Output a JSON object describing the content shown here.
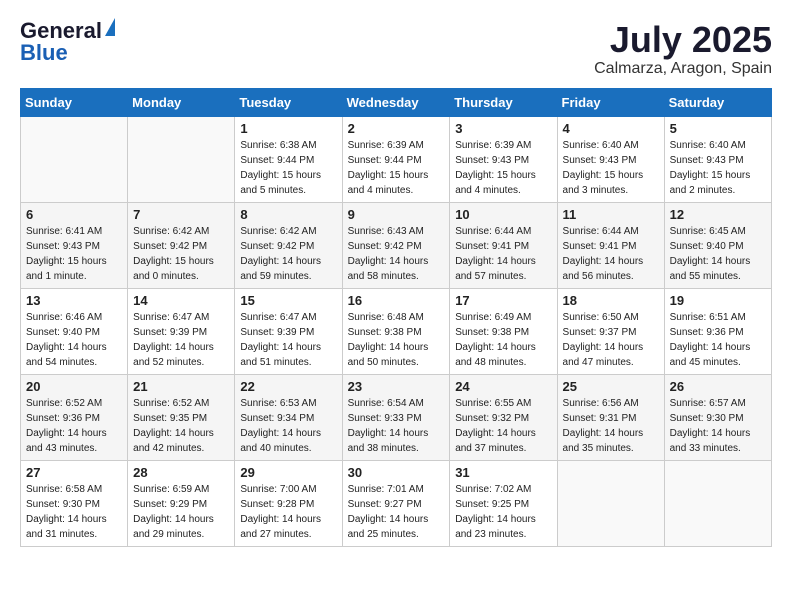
{
  "logo": {
    "general": "General",
    "blue": "Blue"
  },
  "title": {
    "month": "July 2025",
    "location": "Calmarza, Aragon, Spain"
  },
  "headers": [
    "Sunday",
    "Monday",
    "Tuesday",
    "Wednesday",
    "Thursday",
    "Friday",
    "Saturday"
  ],
  "weeks": [
    [
      {
        "day": "",
        "sunrise": "",
        "sunset": "",
        "daylight": ""
      },
      {
        "day": "",
        "sunrise": "",
        "sunset": "",
        "daylight": ""
      },
      {
        "day": "1",
        "sunrise": "Sunrise: 6:38 AM",
        "sunset": "Sunset: 9:44 PM",
        "daylight": "Daylight: 15 hours and 5 minutes."
      },
      {
        "day": "2",
        "sunrise": "Sunrise: 6:39 AM",
        "sunset": "Sunset: 9:44 PM",
        "daylight": "Daylight: 15 hours and 4 minutes."
      },
      {
        "day": "3",
        "sunrise": "Sunrise: 6:39 AM",
        "sunset": "Sunset: 9:43 PM",
        "daylight": "Daylight: 15 hours and 4 minutes."
      },
      {
        "day": "4",
        "sunrise": "Sunrise: 6:40 AM",
        "sunset": "Sunset: 9:43 PM",
        "daylight": "Daylight: 15 hours and 3 minutes."
      },
      {
        "day": "5",
        "sunrise": "Sunrise: 6:40 AM",
        "sunset": "Sunset: 9:43 PM",
        "daylight": "Daylight: 15 hours and 2 minutes."
      }
    ],
    [
      {
        "day": "6",
        "sunrise": "Sunrise: 6:41 AM",
        "sunset": "Sunset: 9:43 PM",
        "daylight": "Daylight: 15 hours and 1 minute."
      },
      {
        "day": "7",
        "sunrise": "Sunrise: 6:42 AM",
        "sunset": "Sunset: 9:42 PM",
        "daylight": "Daylight: 15 hours and 0 minutes."
      },
      {
        "day": "8",
        "sunrise": "Sunrise: 6:42 AM",
        "sunset": "Sunset: 9:42 PM",
        "daylight": "Daylight: 14 hours and 59 minutes."
      },
      {
        "day": "9",
        "sunrise": "Sunrise: 6:43 AM",
        "sunset": "Sunset: 9:42 PM",
        "daylight": "Daylight: 14 hours and 58 minutes."
      },
      {
        "day": "10",
        "sunrise": "Sunrise: 6:44 AM",
        "sunset": "Sunset: 9:41 PM",
        "daylight": "Daylight: 14 hours and 57 minutes."
      },
      {
        "day": "11",
        "sunrise": "Sunrise: 6:44 AM",
        "sunset": "Sunset: 9:41 PM",
        "daylight": "Daylight: 14 hours and 56 minutes."
      },
      {
        "day": "12",
        "sunrise": "Sunrise: 6:45 AM",
        "sunset": "Sunset: 9:40 PM",
        "daylight": "Daylight: 14 hours and 55 minutes."
      }
    ],
    [
      {
        "day": "13",
        "sunrise": "Sunrise: 6:46 AM",
        "sunset": "Sunset: 9:40 PM",
        "daylight": "Daylight: 14 hours and 54 minutes."
      },
      {
        "day": "14",
        "sunrise": "Sunrise: 6:47 AM",
        "sunset": "Sunset: 9:39 PM",
        "daylight": "Daylight: 14 hours and 52 minutes."
      },
      {
        "day": "15",
        "sunrise": "Sunrise: 6:47 AM",
        "sunset": "Sunset: 9:39 PM",
        "daylight": "Daylight: 14 hours and 51 minutes."
      },
      {
        "day": "16",
        "sunrise": "Sunrise: 6:48 AM",
        "sunset": "Sunset: 9:38 PM",
        "daylight": "Daylight: 14 hours and 50 minutes."
      },
      {
        "day": "17",
        "sunrise": "Sunrise: 6:49 AM",
        "sunset": "Sunset: 9:38 PM",
        "daylight": "Daylight: 14 hours and 48 minutes."
      },
      {
        "day": "18",
        "sunrise": "Sunrise: 6:50 AM",
        "sunset": "Sunset: 9:37 PM",
        "daylight": "Daylight: 14 hours and 47 minutes."
      },
      {
        "day": "19",
        "sunrise": "Sunrise: 6:51 AM",
        "sunset": "Sunset: 9:36 PM",
        "daylight": "Daylight: 14 hours and 45 minutes."
      }
    ],
    [
      {
        "day": "20",
        "sunrise": "Sunrise: 6:52 AM",
        "sunset": "Sunset: 9:36 PM",
        "daylight": "Daylight: 14 hours and 43 minutes."
      },
      {
        "day": "21",
        "sunrise": "Sunrise: 6:52 AM",
        "sunset": "Sunset: 9:35 PM",
        "daylight": "Daylight: 14 hours and 42 minutes."
      },
      {
        "day": "22",
        "sunrise": "Sunrise: 6:53 AM",
        "sunset": "Sunset: 9:34 PM",
        "daylight": "Daylight: 14 hours and 40 minutes."
      },
      {
        "day": "23",
        "sunrise": "Sunrise: 6:54 AM",
        "sunset": "Sunset: 9:33 PM",
        "daylight": "Daylight: 14 hours and 38 minutes."
      },
      {
        "day": "24",
        "sunrise": "Sunrise: 6:55 AM",
        "sunset": "Sunset: 9:32 PM",
        "daylight": "Daylight: 14 hours and 37 minutes."
      },
      {
        "day": "25",
        "sunrise": "Sunrise: 6:56 AM",
        "sunset": "Sunset: 9:31 PM",
        "daylight": "Daylight: 14 hours and 35 minutes."
      },
      {
        "day": "26",
        "sunrise": "Sunrise: 6:57 AM",
        "sunset": "Sunset: 9:30 PM",
        "daylight": "Daylight: 14 hours and 33 minutes."
      }
    ],
    [
      {
        "day": "27",
        "sunrise": "Sunrise: 6:58 AM",
        "sunset": "Sunset: 9:30 PM",
        "daylight": "Daylight: 14 hours and 31 minutes."
      },
      {
        "day": "28",
        "sunrise": "Sunrise: 6:59 AM",
        "sunset": "Sunset: 9:29 PM",
        "daylight": "Daylight: 14 hours and 29 minutes."
      },
      {
        "day": "29",
        "sunrise": "Sunrise: 7:00 AM",
        "sunset": "Sunset: 9:28 PM",
        "daylight": "Daylight: 14 hours and 27 minutes."
      },
      {
        "day": "30",
        "sunrise": "Sunrise: 7:01 AM",
        "sunset": "Sunset: 9:27 PM",
        "daylight": "Daylight: 14 hours and 25 minutes."
      },
      {
        "day": "31",
        "sunrise": "Sunrise: 7:02 AM",
        "sunset": "Sunset: 9:25 PM",
        "daylight": "Daylight: 14 hours and 23 minutes."
      },
      {
        "day": "",
        "sunrise": "",
        "sunset": "",
        "daylight": ""
      },
      {
        "day": "",
        "sunrise": "",
        "sunset": "",
        "daylight": ""
      }
    ]
  ]
}
